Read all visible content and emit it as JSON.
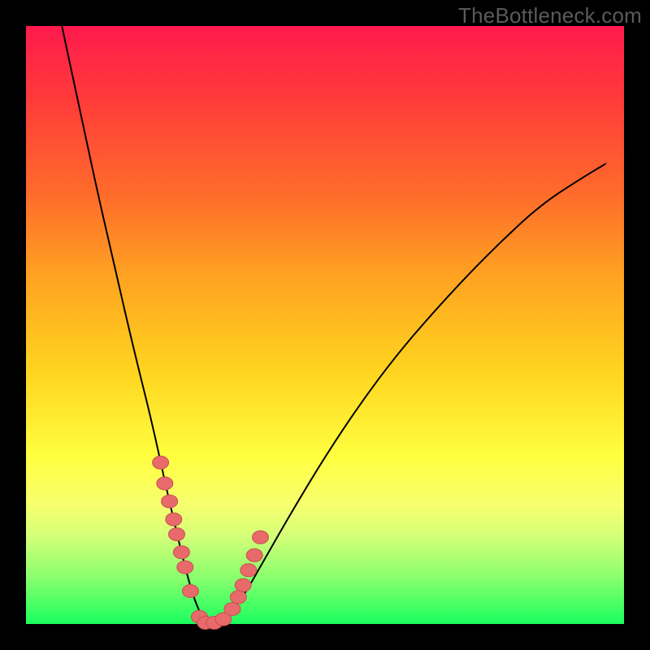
{
  "watermark": "TheBottleneck.com",
  "chart_data": {
    "type": "line",
    "title": "",
    "xlabel": "",
    "ylabel": "",
    "xlim": [
      0,
      1
    ],
    "ylim": [
      0,
      1
    ],
    "series": [
      {
        "name": "curve",
        "x": [
          0.06,
          0.09,
          0.12,
          0.15,
          0.18,
          0.21,
          0.234,
          0.255,
          0.27,
          0.282,
          0.294,
          0.303,
          0.315,
          0.333,
          0.36,
          0.4,
          0.44,
          0.5,
          0.56,
          0.62,
          0.68,
          0.74,
          0.8,
          0.86,
          0.92,
          0.97
        ],
        "y": [
          1.0,
          0.86,
          0.72,
          0.59,
          0.46,
          0.34,
          0.23,
          0.14,
          0.08,
          0.04,
          0.012,
          0.0,
          0.0,
          0.01,
          0.04,
          0.11,
          0.18,
          0.28,
          0.37,
          0.45,
          0.52,
          0.585,
          0.645,
          0.7,
          0.74,
          0.77
        ]
      }
    ],
    "markers": {
      "name": "highlighted-points",
      "x": [
        0.225,
        0.232,
        0.24,
        0.247,
        0.252,
        0.26,
        0.266,
        0.275,
        0.29,
        0.3,
        0.315,
        0.33,
        0.345,
        0.355,
        0.363,
        0.372,
        0.382,
        0.392
      ],
      "y": [
        0.27,
        0.235,
        0.205,
        0.175,
        0.15,
        0.12,
        0.095,
        0.055,
        0.012,
        0.002,
        0.002,
        0.008,
        0.025,
        0.045,
        0.065,
        0.09,
        0.115,
        0.145
      ]
    },
    "background_gradient": {
      "top": "#ff1a4d",
      "bottom": "#1aff5e"
    }
  }
}
